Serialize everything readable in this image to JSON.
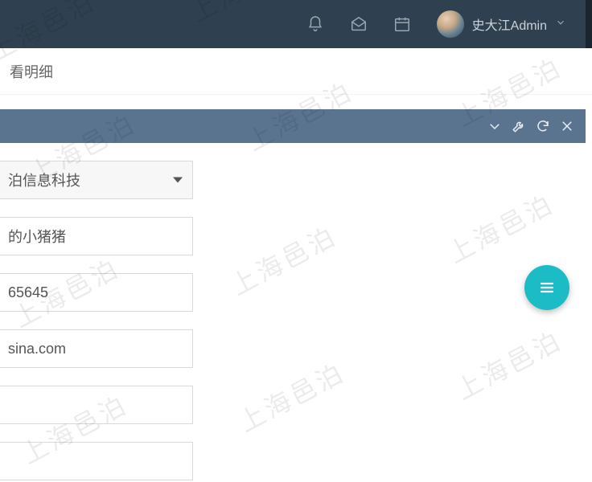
{
  "watermark_text": "上海邑泊",
  "topbar": {
    "user_name": "史大江Admin",
    "icons": {
      "bell": "bell-icon",
      "envelope": "envelope-open-icon",
      "calendar": "calendar-icon"
    }
  },
  "breadcrumb": {
    "text": "看明细"
  },
  "panel_tools": {
    "collapse": "chevron-down-icon",
    "settings": "wrench-icon",
    "refresh": "refresh-icon",
    "close": "close-icon"
  },
  "form": {
    "select_company": {
      "value": "泊信息科技"
    },
    "field_nickname": {
      "value": "的小猪猪"
    },
    "field_number": {
      "value": "65645"
    },
    "field_email": {
      "value": "sina.com"
    },
    "field_blank1": {
      "value": ""
    },
    "field_blank2": {
      "value": ""
    }
  },
  "fab": {
    "label": "menu"
  },
  "colors": {
    "navbar": "#2f4050",
    "panel_header": "#5a7490",
    "fab": "#1bbcc6",
    "border": "#d9d9d9"
  }
}
